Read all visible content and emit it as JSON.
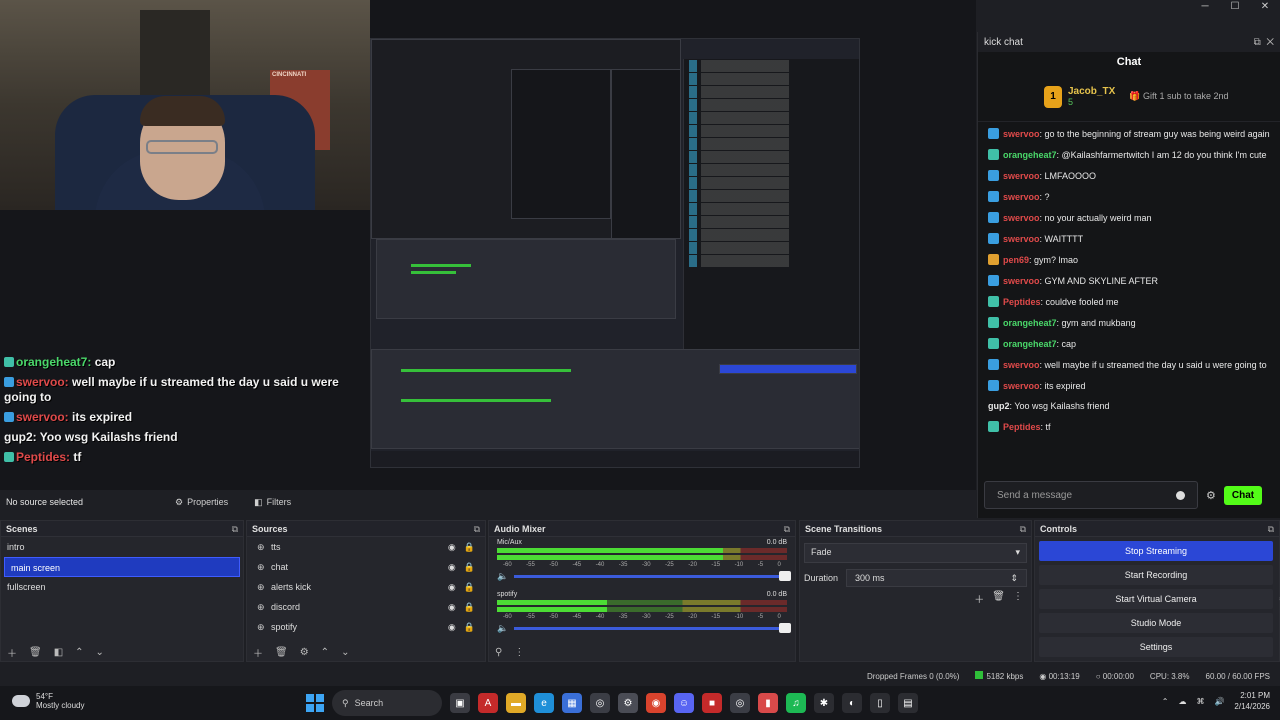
{
  "window": {
    "minimize": "─",
    "maximize": "☐",
    "close": "✕"
  },
  "webcam": {
    "poster_text": "CINCINNATI"
  },
  "preview_chat": [
    {
      "user": "orangeheat7:",
      "text": " cap",
      "color": "#4ad86a",
      "badge": "#40c0a8"
    },
    {
      "user": "swervoo:",
      "text": " well maybe if u streamed the day u said u were going to",
      "color": "#e04a4a",
      "badge": "#3a9ee0"
    },
    {
      "user": "swervoo:",
      "text": " its expired",
      "color": "#e04a4a",
      "badge": "#3a9ee0"
    },
    {
      "user": "gup2:",
      "text": " Yoo wsg Kailashs friend",
      "color": "#f2f2f2",
      "badge": ""
    },
    {
      "user": "Peptides:",
      "text": " tf",
      "color": "#e04a4a",
      "badge": "#40c0a8"
    }
  ],
  "chat_dock": {
    "title": "kick chat",
    "header": "Chat",
    "pinned": {
      "name": "Jacob_TX",
      "sub": "5",
      "gift": "Gift 1 sub to take 2nd",
      "rank": "1"
    },
    "messages": [
      {
        "user": "swervoo",
        "text": ": go to the beginning of stream guy was being weird again",
        "color": "#e04a4a",
        "badge": "#3a9ee0"
      },
      {
        "user": "orangeheat7",
        "text": ": @Kailashfarmertwitch I am 12 do you think I'm cute",
        "color": "#4ad86a",
        "badge": "#40c0a8"
      },
      {
        "user": "swervoo",
        "text": ": LMFAOOOO",
        "color": "#e04a4a",
        "badge": "#3a9ee0"
      },
      {
        "user": "swervoo",
        "text": ": ?",
        "color": "#e04a4a",
        "badge": "#3a9ee0"
      },
      {
        "user": "swervoo",
        "text": ": no your actually weird man",
        "color": "#e04a4a",
        "badge": "#3a9ee0"
      },
      {
        "user": "swervoo",
        "text": ": WAITTTT",
        "color": "#e04a4a",
        "badge": "#3a9ee0"
      },
      {
        "user": "pen69",
        "text": ": gym? lmao",
        "color": "#e04a4a",
        "badge": "#e0a030"
      },
      {
        "user": "swervoo",
        "text": ": GYM AND SKYLINE AFTER",
        "color": "#e04a4a",
        "badge": "#3a9ee0"
      },
      {
        "user": "Peptides",
        "text": ": couldve fooled me",
        "color": "#e04a4a",
        "badge": "#40c0a8"
      },
      {
        "user": "orangeheat7",
        "text": ": gym and mukbang",
        "color": "#4ad86a",
        "badge": "#40c0a8"
      },
      {
        "user": "orangeheat7",
        "text": ": cap",
        "color": "#4ad86a",
        "badge": "#40c0a8"
      },
      {
        "user": "swervoo",
        "text": ": well maybe if u streamed the day u said u were going to",
        "color": "#e04a4a",
        "badge": "#3a9ee0"
      },
      {
        "user": "swervoo",
        "text": ": its expired",
        "color": "#e04a4a",
        "badge": "#3a9ee0"
      },
      {
        "user": "gup2",
        "text": ": Yoo wsg Kailashs friend",
        "color": "#e8e8e8",
        "badge": ""
      },
      {
        "user": "Peptides",
        "text": ": tf",
        "color": "#e04a4a",
        "badge": "#40c0a8"
      }
    ],
    "input_placeholder": "Send a message",
    "send_label": "Chat"
  },
  "source_bar": {
    "no_source": "No source selected",
    "properties": "Properties",
    "filters": "Filters"
  },
  "scenes": {
    "title": "Scenes",
    "items": [
      "intro",
      "main screen",
      "fullscreen"
    ],
    "active": "main screen"
  },
  "sources": {
    "title": "Sources",
    "items": [
      "tts",
      "chat",
      "alerts kick",
      "discord",
      "spotify"
    ]
  },
  "mixer": {
    "title": "Audio Mixer",
    "channels": [
      {
        "name": "Mic/Aux",
        "db": "0.0 dB",
        "level": 0.78
      },
      {
        "name": "spotify",
        "db": "0.0 dB",
        "level": 0.38
      }
    ],
    "scale": [
      "-60",
      "-55",
      "-50",
      "-45",
      "-40",
      "-35",
      "-30",
      "-25",
      "-20",
      "-15",
      "-10",
      "-5",
      "0"
    ]
  },
  "transitions": {
    "title": "Scene Transitions",
    "selected": "Fade",
    "duration_label": "Duration",
    "duration": "300 ms"
  },
  "controls": {
    "title": "Controls",
    "buttons": [
      "Stop Streaming",
      "Start Recording",
      "Start Virtual Camera",
      "Studio Mode",
      "Settings"
    ]
  },
  "status": {
    "dropped": "Dropped Frames 0 (0.0%)",
    "bitrate": "5182 kbps",
    "stream_time": "00:13:19",
    "record_time": "00:00:00",
    "cpu": "CPU: 3.8%",
    "fps": "60.00 / 60.00 FPS"
  },
  "taskbar": {
    "temp": "54°F",
    "weather": "Mostly cloudy",
    "search": "Search",
    "time": "2:01 PM",
    "date": "2/14/2026"
  }
}
